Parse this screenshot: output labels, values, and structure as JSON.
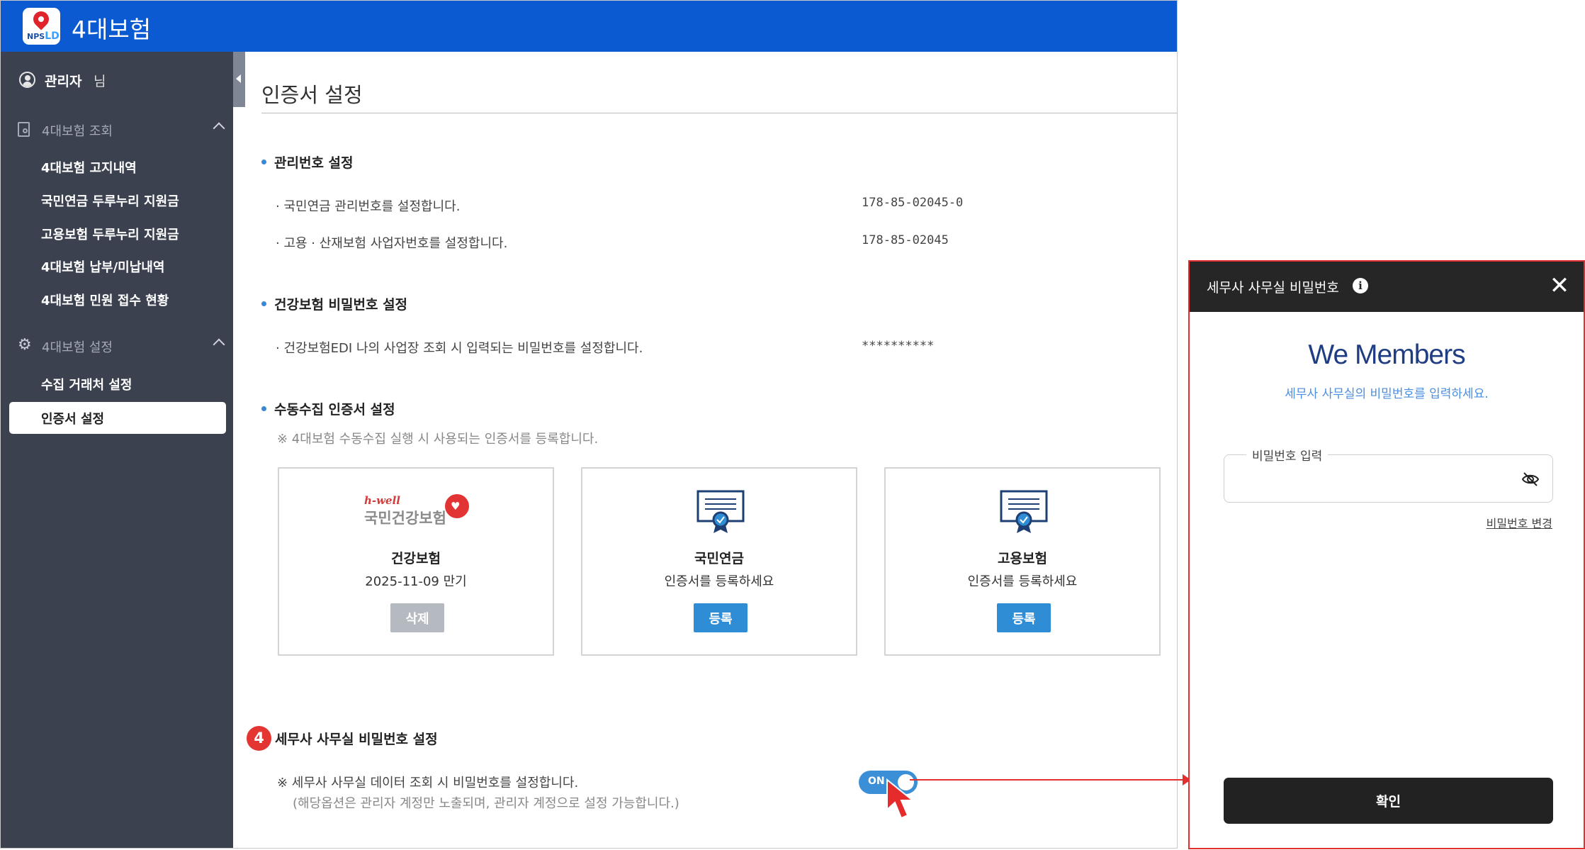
{
  "app": {
    "title": "4대보험",
    "logo_text_a": "NPS",
    "logo_text_b": "LD"
  },
  "sidebar": {
    "user_name": "관리자",
    "user_suffix": "님",
    "groups": [
      {
        "label": "4대보험 조회",
        "items": [
          "4대보험 고지내역",
          "국민연금 두루누리 지원금",
          "고용보험 두루누리 지원금",
          "4대보험 납부/미납내역",
          "4대보험 민원 접수 현황"
        ]
      },
      {
        "label": "4대보험 설정",
        "items": [
          "수집 거래처 설정",
          "인증서 설정"
        ]
      }
    ],
    "active_item": "인증서 설정"
  },
  "page": {
    "title": "인증서 설정",
    "sections": {
      "mgmt": {
        "title": "관리번호 설정",
        "rows": [
          {
            "desc": "· 국민연금 관리번호를 설정합니다.",
            "value": "178-85-02045-0"
          },
          {
            "desc": "· 고용 · 산재보험 사업자번호를 설정합니다.",
            "value": "178-85-02045"
          }
        ]
      },
      "health_pw": {
        "title": "건강보험 비밀번호 설정",
        "desc": "· 건강보험EDI 나의 사업장 조회 시 입력되는 비밀번호를 설정합니다.",
        "value": "**********"
      },
      "cert": {
        "title": "수동수집 인증서 설정",
        "note": "※ 4대보험 수동수집 실행 시 사용되는 인증서를 등록합니다.",
        "cards": [
          {
            "name": "건강보험",
            "sub": "2025-11-09 만기",
            "button": "삭제",
            "logo_small": "h-well",
            "logo_text": "국민건강보험"
          },
          {
            "name": "국민연금",
            "sub": "인증서를 등록하세요",
            "button": "등록"
          },
          {
            "name": "고용보험",
            "sub": "인증서를 등록하세요",
            "button": "등록"
          }
        ]
      },
      "office_pw": {
        "step": "4",
        "title": "세무사 사무실 비밀번호 설정",
        "note1": "※ 세무사 사무실 데이터 조회 시 비밀번호를 설정합니다.",
        "note2": "(해당옵션은 관리자 계정만 노출되며, 관리자 계정으로 설정 가능합니다.)",
        "toggle": "ON"
      }
    }
  },
  "popup": {
    "title": "세무사 사무실 비밀번호",
    "brand": "We Members",
    "subtitle": "세무사 사무실의 비밀번호를 입력하세요.",
    "password_label": "비밀번호 입력",
    "password_value": "",
    "change_link": "비밀번호 변경",
    "confirm": "확인"
  },
  "colors": {
    "topbar": "#0b5ad1",
    "sidebar": "#3c4150",
    "accent": "#2f8dd6",
    "highlight": "#e03030",
    "brand": "#1f3d82"
  }
}
